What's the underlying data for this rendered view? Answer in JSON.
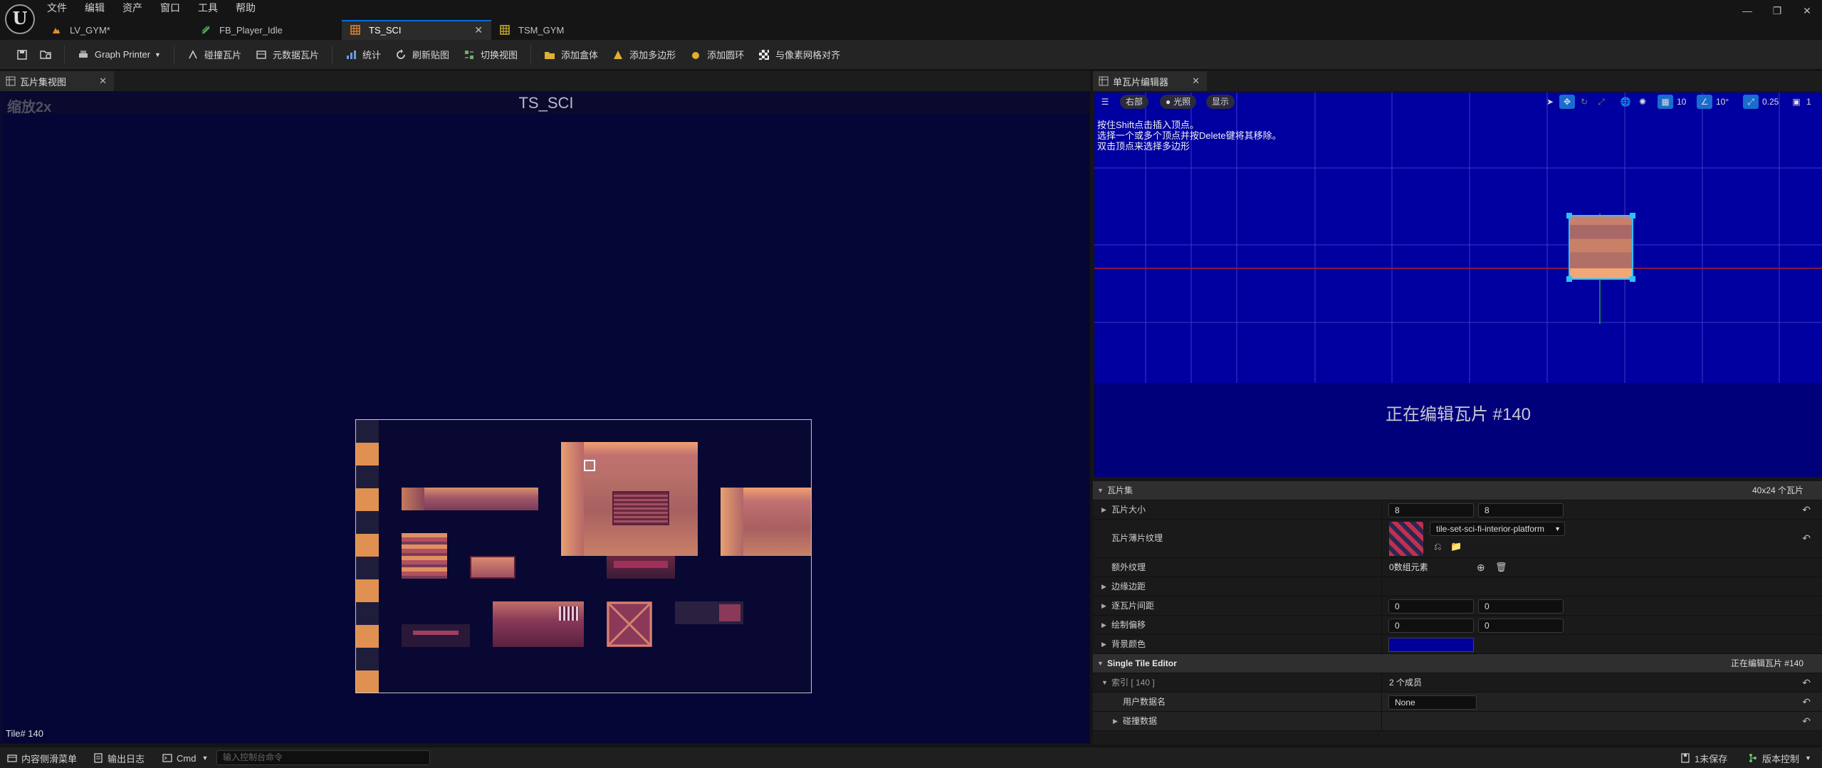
{
  "menu": [
    "文件",
    "编辑",
    "资产",
    "窗口",
    "工具",
    "帮助"
  ],
  "tabs": [
    {
      "label": "LV_GYM*",
      "icon": "level-icon",
      "active": false
    },
    {
      "label": "FB_Player_Idle",
      "icon": "flipbook-icon",
      "active": false
    },
    {
      "label": "TS_SCI",
      "icon": "tileset-icon",
      "active": true
    },
    {
      "label": "TSM_GYM",
      "icon": "tilemap-icon",
      "active": false
    }
  ],
  "toolbar": {
    "graph_printer": "Graph Printer",
    "collision_tiles": "碰撞瓦片",
    "metadata_tiles": "元数据瓦片",
    "stats": "统计",
    "refresh_texture": "刷新贴图",
    "toggle_view": "切换视图",
    "add_box": "添加盒体",
    "add_polygon": "添加多边形",
    "add_circle": "添加圆环",
    "pixel_grid": "与像素网格对齐"
  },
  "left_panel": {
    "tab_label": "瓦片集视图",
    "zoom": "缩放2x",
    "title": "TS_SCI",
    "status": "Tile# 140"
  },
  "right_panel": {
    "tab_label": "单瓦片编辑器",
    "view_mode": "右部",
    "lighting": "光照",
    "show": "显示",
    "grid_size": "10",
    "rotation_snap": "10°",
    "scale_snap": "0.25",
    "camera_speed": "1",
    "help_lines": [
      "按住Shift点击插入顶点。",
      "选择一个或多个顶点并按Delete键将其移除。",
      "双击顶点来选择多边形"
    ],
    "editing_label": "正在编辑瓦片 #140"
  },
  "details": {
    "tileset_label": "瓦片集",
    "tileset_value": "40x24 个瓦片",
    "tile_size_label": "瓦片大小",
    "tile_size_x": "8",
    "tile_size_y": "8",
    "tile_sheet_label": "瓦片薄片纹理",
    "tile_sheet_value": "tile-set-sci-fi-interior-platform",
    "extra_tex_label": "额外纹理",
    "extra_tex_value": "0数组元素",
    "margin_label": "边缘边距",
    "spacing_label": "逐瓦片间距",
    "spacing_x": "0",
    "spacing_y": "0",
    "draw_offset_label": "绘制偏移",
    "draw_offset_x": "0",
    "draw_offset_y": "0",
    "bg_color_label": "背景颜色",
    "bg_color": "#000099",
    "single_tile_label": "Single Tile Editor",
    "single_tile_value": "正在编辑瓦片 #140",
    "index_label": "索引 [ 140 ]",
    "index_value": "2 个成员",
    "user_data_label": "用户数据名",
    "user_data_value": "None",
    "collision_label": "碰撞数据"
  },
  "statusbar": {
    "content_drawer": "内容侧滑菜单",
    "output_log": "输出日志",
    "cmd": "Cmd",
    "console_placeholder": "输入控制台命令",
    "unsaved": "1未保存",
    "source_control": "版本控制"
  }
}
